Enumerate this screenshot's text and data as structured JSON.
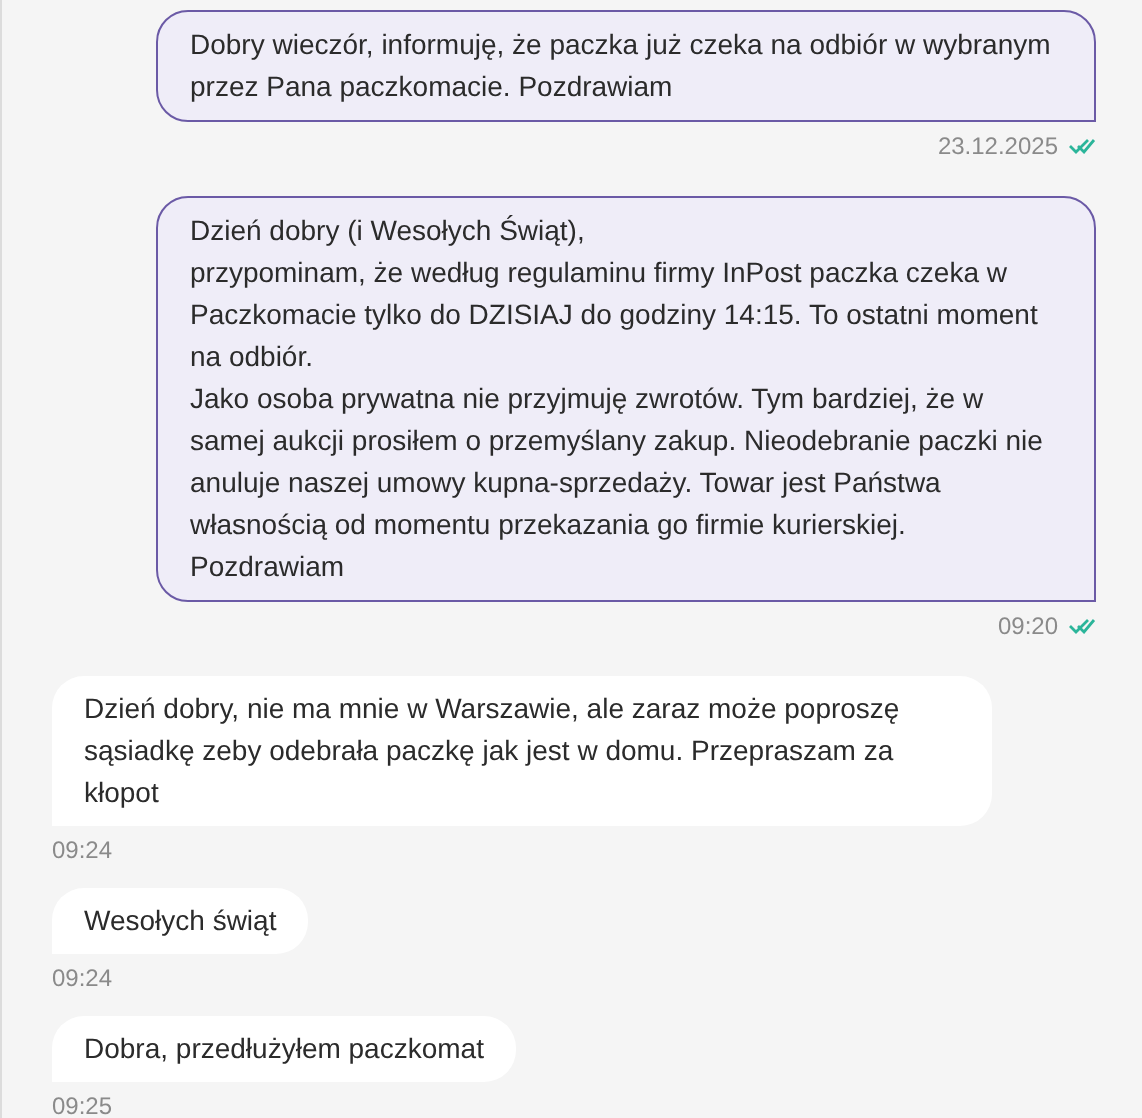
{
  "messages": [
    {
      "kind": "sent",
      "text": "Dobry wieczór, informuję, że paczka już czeka na odbiór w wybranym przez Pana paczkomacie. Pozdrawiam",
      "time": "23.12.2025",
      "read": true
    },
    {
      "kind": "sent",
      "text": "Dzień dobry (i Wesołych Świąt),\nprzypominam, że według regulaminu firmy InPost paczka czeka w Paczkomacie tylko do DZISIAJ do godziny 14:15. To ostatni moment na odbiór.\nJako osoba prywatna nie przyjmuję zwrotów. Tym bardziej, że w samej aukcji prosiłem o przemyślany zakup. Nieodebranie paczki nie anuluje naszej umowy kupna-sprzedaży. Towar jest Państwa własnością od momentu przekazania go firmie kurierskiej.\nPozdrawiam",
      "time": "09:20",
      "read": true
    },
    {
      "kind": "received",
      "text": "Dzień dobry, nie ma mnie w Warszawie, ale zaraz może poproszę sąsiadkę zeby odebrała paczkę jak jest w domu. Przepraszam za kłopot",
      "time": "09:24"
    },
    {
      "kind": "received",
      "text": "Wesołych świąt",
      "time": "09:24"
    },
    {
      "kind": "received",
      "text": "Dobra, przedłużyłem paczkomat",
      "time": "09:25"
    }
  ]
}
